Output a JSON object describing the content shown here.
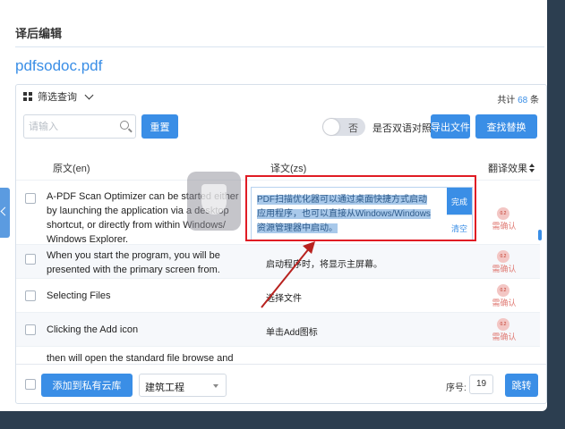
{
  "window": {
    "title": "译后编辑"
  },
  "file": {
    "name": "pdfsodoc.pdf"
  },
  "filter": {
    "label": "筛选查询"
  },
  "total": {
    "prefix": "共计",
    "count": "68",
    "suffix": "条"
  },
  "search": {
    "placeholder": "请输入"
  },
  "toolbar": {
    "reset_label": "重置",
    "toggle_label": "否",
    "bilingual_label": "是否双语对照",
    "export_label": "导出文件",
    "replace_label": "查找替换"
  },
  "columns": {
    "source": "原文(en)",
    "target": "译文(zs)",
    "effect": "翻译效果"
  },
  "rows": [
    {
      "source": "A-PDF Scan Optimizer can be started either by launching the application via a desktop shortcut, or directly from within Windows/ Windows Explorer.",
      "target": "",
      "badge": "0.2",
      "status": "需确认"
    },
    {
      "source": "When you start the program, you will be presented with the primary screen from.",
      "target": "启动程序时，将显示主屏幕。",
      "badge": "0.2",
      "status": "需确认"
    },
    {
      "source": "Selecting Files",
      "target": "选择文件",
      "badge": "0.2",
      "status": "需确认"
    },
    {
      "source": "Clicking the Add icon",
      "target": "单击Add图标",
      "badge": "0.2",
      "status": "需确认"
    },
    {
      "source": "then will open the standard file browse and",
      "target": "",
      "badge": "",
      "status": ""
    }
  ],
  "editor": {
    "text": "PDF扫描优化器可以通过桌面快捷方式启动应用程序，也可以直接从Windows/Windows资源管理器中启动。",
    "done_label": "完成",
    "clear_label": "清空"
  },
  "bottom": {
    "add_label": "添加到私有云库",
    "category": "建筑工程",
    "seq_label": "序号:",
    "seq_value": "19",
    "jump_label": "跳转"
  },
  "colors": {
    "accent": "#3a8ee6",
    "highlight": "#e01b24"
  }
}
